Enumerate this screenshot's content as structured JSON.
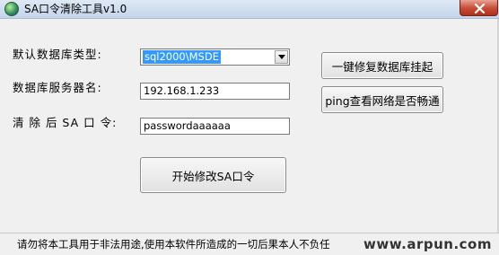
{
  "window": {
    "title": "SA口令清除工具v1.0"
  },
  "form": {
    "db_type_label": "默认数据库类型:",
    "db_type_value": "sql2000\\MSDE",
    "server_name_label": "数据库服务器名:",
    "server_name_value": "192.168.1.233",
    "password_label": "清 除 后 SA 口 令:",
    "password_value": "passwordaaaaaa"
  },
  "buttons": {
    "repair_label": "一键修复数据库挂起",
    "ping_label": "ping查看网络是否畅通",
    "start_label": "开始修改SA口令"
  },
  "statusbar": {
    "text": "请勿将本工具用于非法用途,使用本软件所造成的一切后果本人不负任",
    "watermark": "www.arpun.com"
  },
  "icons": {
    "app": "globe-icon",
    "close": "close-icon",
    "dropdown": "chevron-down-icon"
  },
  "colors": {
    "selection": "#3399ff",
    "close_button": "#c64a33"
  }
}
